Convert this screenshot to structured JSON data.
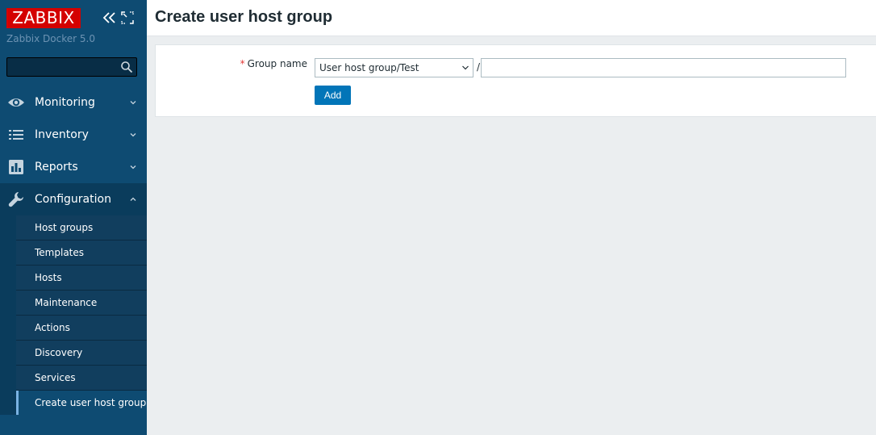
{
  "app": {
    "logo_text": "ZABBIX",
    "server_name": "Zabbix Docker 5.0"
  },
  "search": {
    "value": "",
    "placeholder": ""
  },
  "menu": [
    {
      "label": "Monitoring",
      "icon": "eye-icon",
      "expanded": false
    },
    {
      "label": "Inventory",
      "icon": "list-icon",
      "expanded": false
    },
    {
      "label": "Reports",
      "icon": "bar-chart-icon",
      "expanded": false
    },
    {
      "label": "Configuration",
      "icon": "wrench-icon",
      "expanded": true
    }
  ],
  "submenu": [
    {
      "label": "Host groups"
    },
    {
      "label": "Templates"
    },
    {
      "label": "Hosts"
    },
    {
      "label": "Maintenance"
    },
    {
      "label": "Actions"
    },
    {
      "label": "Discovery"
    },
    {
      "label": "Services"
    },
    {
      "label": "Create user host group",
      "selected": true
    }
  ],
  "page": {
    "title": "Create user host group"
  },
  "form": {
    "required_marker": "*",
    "group_name_label": "Group name",
    "group_select_value": "User host group/Test",
    "separator": "/",
    "group_name_value": "",
    "add_label": "Add"
  },
  "colors": {
    "sidebar_bg": "#0e4b72",
    "logo_red": "#d40000",
    "button_blue": "#0275b8",
    "page_bg": "#ebeef0",
    "required_red": "#e33734"
  }
}
